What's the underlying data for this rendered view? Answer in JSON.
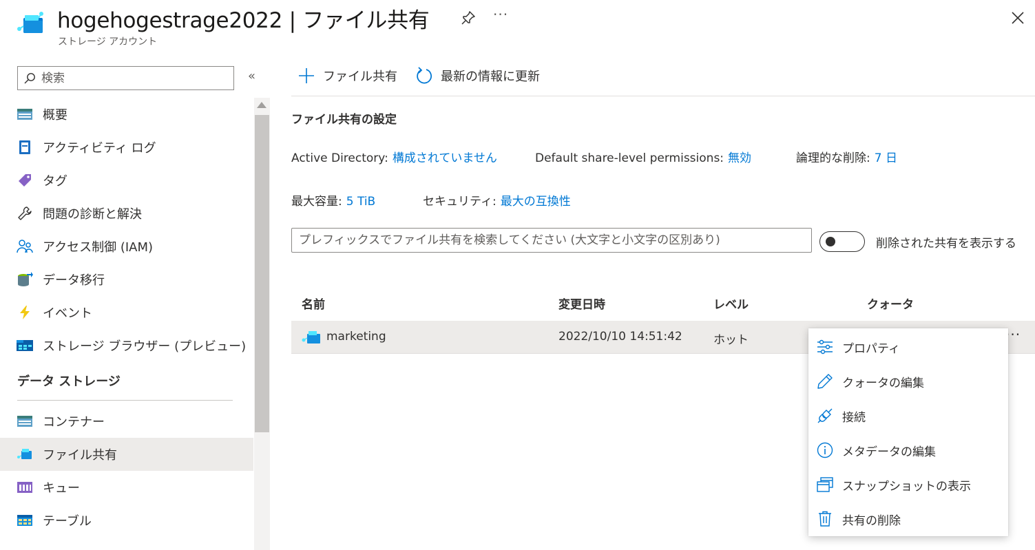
{
  "header": {
    "title": "hogehogestrage2022 | ファイル共有",
    "subtitle": "ストレージ アカウント",
    "more_label": "···"
  },
  "sidebar": {
    "search_placeholder": "検索",
    "collapse_label": "«",
    "items": [
      {
        "label": "概要",
        "icon": "overview-icon"
      },
      {
        "label": "アクティビティ ログ",
        "icon": "activity-log-icon"
      },
      {
        "label": "タグ",
        "icon": "tag-icon"
      },
      {
        "label": "問題の診断と解決",
        "icon": "wrench-icon"
      },
      {
        "label": "アクセス制御 (IAM)",
        "icon": "people-icon"
      },
      {
        "label": "データ移行",
        "icon": "data-migration-icon"
      },
      {
        "label": "イベント",
        "icon": "lightning-icon"
      },
      {
        "label": "ストレージ ブラウザー (プレビュー)",
        "icon": "storage-browser-icon"
      }
    ],
    "section_title": "データ ストレージ",
    "section_items": [
      {
        "label": "コンテナー",
        "icon": "container-icon"
      },
      {
        "label": "ファイル共有",
        "icon": "file-share-icon",
        "active": true
      },
      {
        "label": "キュー",
        "icon": "queue-icon"
      },
      {
        "label": "テーブル",
        "icon": "table-icon"
      }
    ]
  },
  "toolbar": {
    "add_label": "ファイル共有",
    "refresh_label": "最新の情報に更新"
  },
  "settings": {
    "title": "ファイル共有の設定",
    "ad_label": "Active Directory:",
    "ad_value": "構成されていません",
    "perm_label": "Default share-level permissions:",
    "perm_value": "無効",
    "softdel_label": "論理的な削除:",
    "softdel_value": "7 日",
    "capacity_label": "最大容量:",
    "capacity_value": "5 TiB",
    "security_label": "セキュリティ:",
    "security_value": "最大の互換性"
  },
  "filter": {
    "placeholder": "プレフィックスでファイル共有を検索してください (大文字と小文字の区別あり)",
    "toggle_label": "削除された共有を表示する",
    "toggle_on": false
  },
  "table": {
    "headers": {
      "name": "名前",
      "modified": "変更日時",
      "tier": "レベル",
      "quota": "クォータ"
    },
    "rows": [
      {
        "name": "marketing",
        "modified": "2022/10/10 14:51:42",
        "tier": "ホット",
        "quota": ""
      }
    ],
    "row_more_label": "···"
  },
  "context_menu": {
    "items": [
      {
        "label": "プロパティ",
        "icon": "properties-icon"
      },
      {
        "label": "クォータの編集",
        "icon": "pencil-icon"
      },
      {
        "label": "接続",
        "icon": "plug-icon"
      },
      {
        "label": "メタデータの編集",
        "icon": "info-icon"
      },
      {
        "label": "スナップショットの表示",
        "icon": "snapshot-icon"
      },
      {
        "label": "共有の削除",
        "icon": "trash-icon"
      }
    ]
  },
  "colors": {
    "accent": "#0078d4",
    "selected_bg": "#edebe9",
    "text": "#323130"
  }
}
